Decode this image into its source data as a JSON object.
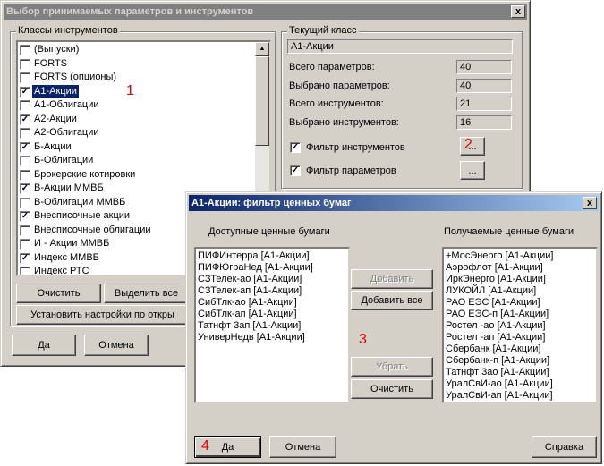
{
  "main_dialog": {
    "title": "Выбор принимаемых параметров и инструментов",
    "close": "x",
    "classes_group_title": "Классы инструментов",
    "classes": [
      {
        "label": "(Выпуски)",
        "checked": false,
        "selected": false
      },
      {
        "label": "FORTS",
        "checked": false,
        "selected": false
      },
      {
        "label": "FORTS (опционы)",
        "checked": false,
        "selected": false
      },
      {
        "label": "A1-Акции",
        "checked": true,
        "selected": true
      },
      {
        "label": "A1-Облигации",
        "checked": false,
        "selected": false
      },
      {
        "label": "A2-Акции",
        "checked": true,
        "selected": false
      },
      {
        "label": "A2-Облигации",
        "checked": false,
        "selected": false
      },
      {
        "label": "Б-Акции",
        "checked": true,
        "selected": false
      },
      {
        "label": "Б-Облигации",
        "checked": false,
        "selected": false
      },
      {
        "label": "Брокерские котировки",
        "checked": false,
        "selected": false
      },
      {
        "label": "В-Акции ММВБ",
        "checked": true,
        "selected": false
      },
      {
        "label": "В-Облигации ММВБ",
        "checked": false,
        "selected": false
      },
      {
        "label": "Внесписочные акции",
        "checked": true,
        "selected": false
      },
      {
        "label": "Внесписочные облигации",
        "checked": false,
        "selected": false
      },
      {
        "label": "И - Акции ММВБ",
        "checked": false,
        "selected": false
      },
      {
        "label": "Индекс ММВБ",
        "checked": true,
        "selected": false
      },
      {
        "label": "Индекс РТС",
        "checked": false,
        "selected": false
      }
    ],
    "clear_button": "Очистить",
    "select_all_button": "Выделить все",
    "apply_settings_button": "Установить настройки по откры",
    "ok_button": "Да",
    "cancel_button": "Отмена",
    "current_class_group_title": "Текущий класс",
    "current_class_value": "A1-Акции",
    "stats": [
      {
        "label": "Всего параметров:",
        "value": "40"
      },
      {
        "label": "Выбрано параметров:",
        "value": "40"
      },
      {
        "label": "Всего инструментов:",
        "value": "21"
      },
      {
        "label": "Выбрано инструментов:",
        "value": "16"
      }
    ],
    "instrument_filter_label": "Фильтр инструментов",
    "instrument_filter_checked": true,
    "parameter_filter_label": "Фильтр параметров",
    "parameter_filter_checked": true,
    "ellipsis": "..."
  },
  "filter_dialog": {
    "title": "A1-Акции: фильтр ценных бумаг",
    "close": "x",
    "available_label": "Доступные ценные бумаги",
    "received_label": "Получаемые ценные бумаги",
    "available": [
      "ПИФИнтерра [A1-Акции]",
      "ПИФЮграНед [A1-Акции]",
      "СЗТелек-ао [A1-Акции]",
      "СЗТелек-ап [A1-Акции]",
      "СибТлк-ао [A1-Акции]",
      "СибТлк-ап [A1-Акции]",
      "Татнфт 3ап [A1-Акции]",
      "УниверНедв [A1-Акции]"
    ],
    "received": [
      "+МосЭнерго [A1-Акции]",
      "Аэрофлот [A1-Акции]",
      "ИркЭнерго [A1-Акции]",
      "ЛУКОЙЛ [A1-Акции]",
      "РАО ЕЭС [A1-Акции]",
      "РАО ЕЭС-п [A1-Акции]",
      "Ростел -ао [A1-Акции]",
      "Ростел -ап [A1-Акции]",
      "Сбербанк [A1-Акции]",
      "Сбербанк-п [A1-Акции]",
      "Татнфт 3ао [A1-Акции]",
      "УралСвИ-ао [A1-Акции]",
      "УралСвИ-ап [A1-Акции]"
    ],
    "add_button": "Добавить",
    "add_all_button": "Добавить все",
    "remove_button": "Убрать",
    "clear_button": "Очистить",
    "ok_button": "Да",
    "cancel_button": "Отмена",
    "help_button": "Справка"
  },
  "annotations": {
    "n1": "1",
    "n2": "2",
    "n3": "3",
    "n4": "4"
  }
}
